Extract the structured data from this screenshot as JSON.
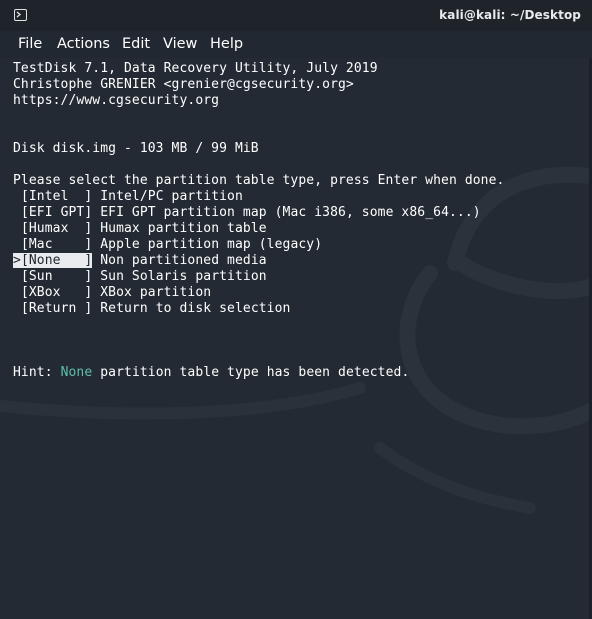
{
  "window": {
    "title": "kali@kali: ~/Desktop"
  },
  "menu": {
    "items": [
      "File",
      "Actions",
      "Edit",
      "View",
      "Help"
    ]
  },
  "terminal": {
    "header": [
      "TestDisk 7.1, Data Recovery Utility, July 2019",
      "Christophe GRENIER <grenier@cgsecurity.org>",
      "https://www.cgsecurity.org"
    ],
    "disk_line": "Disk disk.img - 103 MB / 99 MiB",
    "prompt": "Please select the partition table type, press Enter when done.",
    "options": [
      {
        "key": "[Intel  ]",
        "desc": "Intel/PC partition",
        "selected": false
      },
      {
        "key": "[EFI GPT]",
        "desc": "EFI GPT partition map (Mac i386, some x86_64...)",
        "selected": false
      },
      {
        "key": "[Humax  ]",
        "desc": "Humax partition table",
        "selected": false
      },
      {
        "key": "[Mac    ]",
        "desc": "Apple partition map (legacy)",
        "selected": false
      },
      {
        "key": "[None   ]",
        "desc": "Non partitioned media",
        "selected": true
      },
      {
        "key": "[Sun    ]",
        "desc": "Sun Solaris partition",
        "selected": false
      },
      {
        "key": "[XBox   ]",
        "desc": "XBox partition",
        "selected": false
      },
      {
        "key": "[Return ]",
        "desc": "Return to disk selection",
        "selected": false
      }
    ],
    "selection_marker": ">",
    "hint": {
      "label": "Hint:",
      "value": "None",
      "text": "partition table type has been detected."
    }
  },
  "colors": {
    "background": "#232a33",
    "text": "#ffffff",
    "highlight_bg": "#e9ebef",
    "hint_accent": "#5ec1a8"
  }
}
